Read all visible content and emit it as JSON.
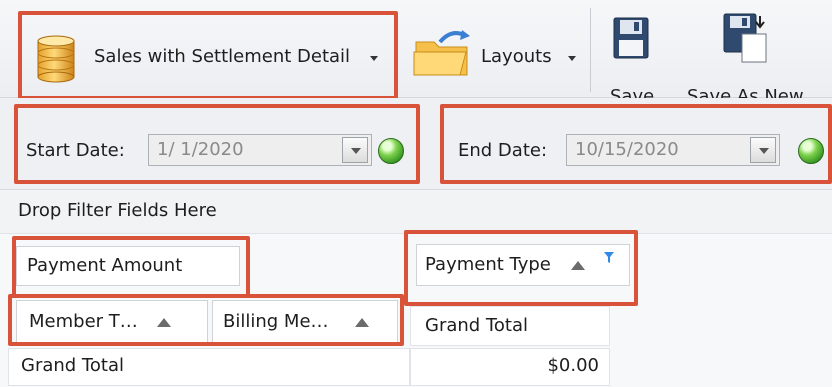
{
  "toolbar": {
    "report_name": "Sales with Settlement Detail",
    "layouts_label": "Layouts",
    "save_label": "Save",
    "save_as_new_label": "Save As New"
  },
  "filters": {
    "start_date_label": "Start Date:",
    "start_date_value": "1/  1/2020",
    "end_date_label": "End Date:",
    "end_date_value": "10/15/2020"
  },
  "pivot": {
    "drop_filter_text": "Drop Filter Fields Here",
    "data_field": "Payment Amount",
    "column_field": "Payment Type",
    "row_fields": [
      "Member T…",
      "Billing Me…"
    ],
    "column_header": "Grand Total",
    "row_total_label": "Grand Total",
    "grand_total_value": "$0.00"
  },
  "colors": {
    "highlight": "#d9533a",
    "status_ok": "#3fa82a",
    "filter_icon": "#2e8ae6"
  }
}
